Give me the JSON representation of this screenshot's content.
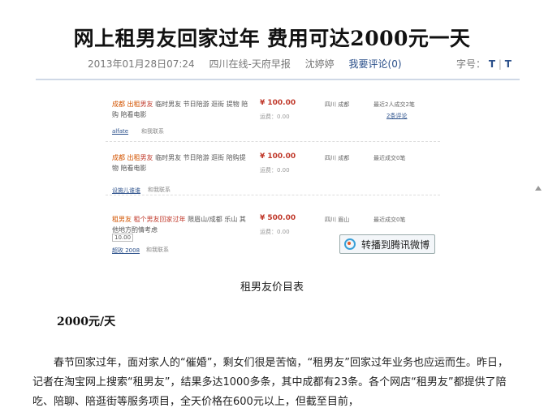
{
  "article": {
    "title": "网上租男友回家过年 费用可达2000元一天",
    "date": "2013年01月28日07:24",
    "source": "四川在线-天府早报",
    "author": "沈婷婷",
    "comment_label": "我要评论",
    "comment_count": "(0)",
    "fontsize_label": "字号：",
    "font_large": "T",
    "font_small": "T"
  },
  "listings": [
    {
      "name_prefix": "成都 出租",
      "name_hl": "男友",
      "name_rest": " 临时男友 节日陪游 逛街 提物 陪购 陪看电影",
      "price": "¥ 100.00",
      "ship": "运费：0.00",
      "location": "四川 成都",
      "deals": "最近2人成交2笔",
      "reviews": "2条评论",
      "seller": "alfate",
      "contact": "和我联系"
    },
    {
      "name_prefix": "成都 出租",
      "name_hl": "男友",
      "name_rest": " 临时男友 节日陪游 逛街 陪购提物 陪看电影",
      "price": "¥ 100.00",
      "ship": "运费：0.00",
      "location": "四川 成都",
      "deals": "最近成交0笔",
      "reviews": "",
      "seller": "设施儿谁谁",
      "contact": "和我联系"
    },
    {
      "name_prefix": "租男友",
      "name_hl": " 租个男友回家过年",
      "name_rest": " 限眉山/成都 乐山 其他地方酌情考虑",
      "tag": "10.00",
      "price": "¥ 500.00",
      "ship": "运费：0.00",
      "location": "四川 眉山",
      "deals": "最近成交0笔",
      "reviews": "",
      "seller": "超玫 2008",
      "contact": "和我联系"
    }
  ],
  "share_button": "转播到腾讯微博",
  "caption": "租男友价目表",
  "subhead": "2000元/天",
  "paragraph": "春节回家过年，面对家人的“催婚”，剩女们很是苦恼，“租男友”回家过年业务也应运而生。昨日，记者在淘宝网上搜索“租男友”，结果多达1000多条，其中成都有23条。各个网店“租男友”都提供了陪吃、陪聊、陪逛街等服务项目，全天价格在600元以上，但截至目前，"
}
